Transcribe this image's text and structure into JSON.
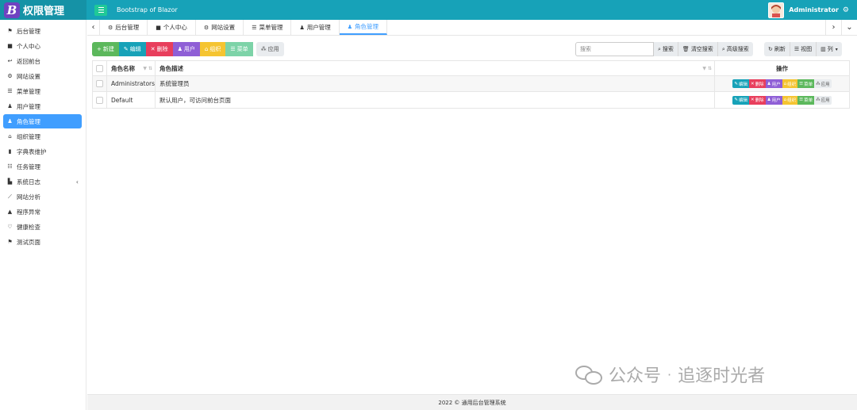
{
  "header": {
    "brand_logo": "B",
    "brand_name": "权限管理",
    "title": "Bootstrap of Blazor",
    "username": "Administrator"
  },
  "sidebar": {
    "items": [
      {
        "label": "后台管理",
        "icon": "flag-icon"
      },
      {
        "label": "个人中心",
        "icon": "briefcase-icon"
      },
      {
        "label": "返回前台",
        "icon": "return-icon"
      },
      {
        "label": "网站设置",
        "icon": "gear-icon"
      },
      {
        "label": "菜单管理",
        "icon": "bars-icon"
      },
      {
        "label": "用户管理",
        "icon": "user-gear-icon"
      },
      {
        "label": "角色管理",
        "icon": "users-icon"
      },
      {
        "label": "组织管理",
        "icon": "building-icon"
      },
      {
        "label": "字典表维护",
        "icon": "book-icon"
      },
      {
        "label": "任务管理",
        "icon": "tasks-icon"
      },
      {
        "label": "系统日志",
        "icon": "chart-icon"
      },
      {
        "label": "网站分析",
        "icon": "line-chart-icon"
      },
      {
        "label": "程序异常",
        "icon": "warning-icon"
      },
      {
        "label": "健康检查",
        "icon": "heartbeat-icon"
      },
      {
        "label": "测试页面",
        "icon": "flag-icon"
      }
    ],
    "active_index": 6
  },
  "tabs": [
    {
      "label": "后台管理",
      "icon": "gear-icon"
    },
    {
      "label": "个人中心",
      "icon": "briefcase-icon"
    },
    {
      "label": "网站设置",
      "icon": "gear-icon"
    },
    {
      "label": "菜单管理",
      "icon": "bars-icon"
    },
    {
      "label": "用户管理",
      "icon": "user-gear-icon"
    },
    {
      "label": "角色管理",
      "icon": "users-icon"
    }
  ],
  "toolbar": {
    "add": "新建",
    "edit": "编辑",
    "delete": "删除",
    "user": "用户",
    "group": "组织",
    "menu": "菜单",
    "app": "应用"
  },
  "search": {
    "placeholder": "搜索",
    "search_btn": "搜索",
    "clear_btn": "清空搜索",
    "advanced_btn": "高级搜索",
    "refresh_btn": "刷新",
    "view_btn": "视图",
    "columns_btn": "列"
  },
  "table": {
    "columns": [
      "角色名称",
      "角色描述",
      "操作"
    ],
    "rows": [
      {
        "name": "Administrators",
        "desc": "系统管理员"
      },
      {
        "name": "Default",
        "desc": "默认用户，可访问前台页面"
      }
    ],
    "ops": [
      "编辑",
      "删除",
      "用户",
      "组织",
      "菜单",
      "应用"
    ]
  },
  "footer": {
    "text": "2022 © 通用后台管理系统"
  },
  "watermark": {
    "text1": "公众号",
    "sep": "·",
    "text2": "追逐时光者"
  },
  "colors": {
    "header": "#17a2b8",
    "active": "#409eff",
    "green": "#5cb85c",
    "cyan": "#17a2b8",
    "red": "#e83e5c",
    "purple": "#8f5fd6",
    "yellow": "#f5c431",
    "lightgreen": "#7dd3a8"
  }
}
